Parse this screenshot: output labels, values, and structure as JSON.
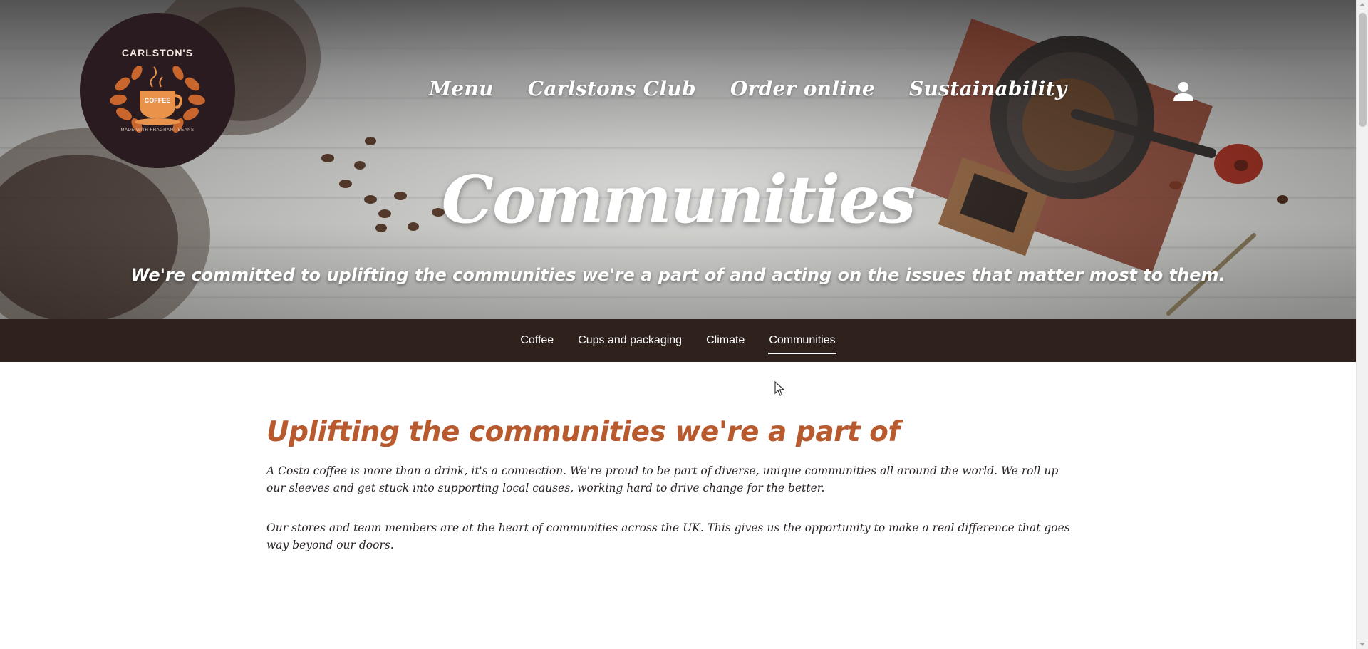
{
  "brand": {
    "logo_name": "CARLSTON'S",
    "logo_center": "COFFEE",
    "logo_tagline": "MADE WITH FRAGRANT BEANS"
  },
  "nav": {
    "items": [
      {
        "label": "Menu"
      },
      {
        "label": "Carlstons Club"
      },
      {
        "label": "Order online"
      },
      {
        "label": "Sustainability"
      }
    ],
    "user_icon": "user-icon"
  },
  "hero": {
    "title": "Communities",
    "subtitle": "We're committed to uplifting the communities we're a part of and acting on the issues that matter most to them."
  },
  "subnav": {
    "items": [
      {
        "label": "Coffee",
        "active": false
      },
      {
        "label": "Cups and packaging",
        "active": false
      },
      {
        "label": "Climate",
        "active": false
      },
      {
        "label": "Communities",
        "active": true
      }
    ]
  },
  "content": {
    "heading": "Uplifting the communities we're a part of",
    "paragraphs": [
      "A Costa coffee is more than a drink, it's a connection. We're proud to be part of diverse, unique communities all around the world. We roll up our sleeves and get stuck into supporting local causes, working hard to drive change for the better.",
      "Our stores and team members are at the heart of communities across the UK. This gives us the opportunity to make a real difference that goes way beyond our doors."
    ]
  },
  "colors": {
    "accent": "#b85a2e",
    "subnav_bg": "#2f221d",
    "logo_bg": "#2a1b20"
  }
}
